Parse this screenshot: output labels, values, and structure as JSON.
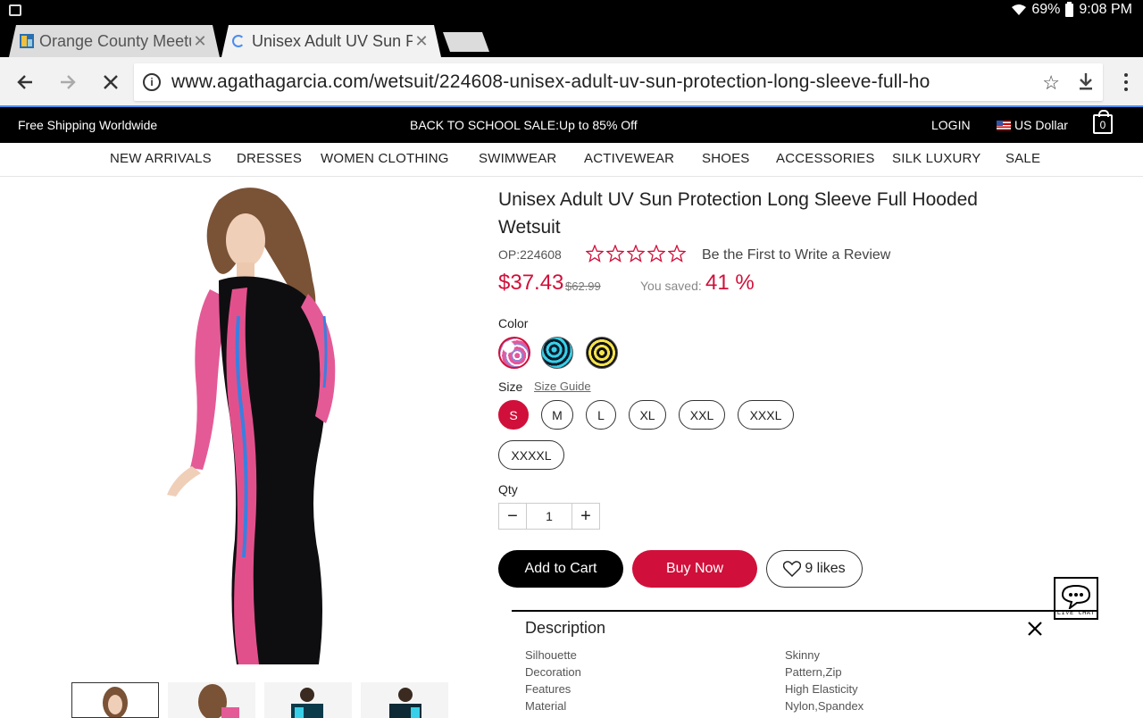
{
  "status": {
    "battery": "69%",
    "time": "9:08 PM"
  },
  "tabs": [
    {
      "title": "Orange County Meetup",
      "active": false
    },
    {
      "title": "Unisex Adult UV Sun Protection",
      "active": true
    }
  ],
  "address": {
    "url": "www.agathagarcia.com/wetsuit/224608-unisex-adult-uv-sun-protection-long-sleeve-full-ho"
  },
  "topbar": {
    "shipping": "Free Shipping Worldwide",
    "promo": "BACK TO SCHOOL SALE:Up to 85% Off",
    "login": "LOGIN",
    "currency": "US Dollar",
    "cart_count": "0"
  },
  "nav": [
    "NEW ARRIVALS",
    "DRESSES",
    "WOMEN CLOTHING",
    "SWIMWEAR",
    "ACTIVEWEAR",
    "SHOES",
    "ACCESSORIES",
    "SILK LUXURY",
    "SALE"
  ],
  "product": {
    "title": "Unisex Adult UV Sun Protection Long Sleeve Full Hooded Wetsuit",
    "sku": "OP:224608",
    "rating": 0,
    "review_link": "Be the First to Write a Review",
    "price": "$37.43",
    "old_price": "$62.99",
    "saved_label": "You saved:",
    "saved_pct": "41 %",
    "color_label": "Color",
    "size_label": "Size",
    "size_guide": "Size Guide",
    "sizes": [
      "S",
      "M",
      "L",
      "XL",
      "XXL",
      "XXXL",
      "XXXXL"
    ],
    "selected_size": "S",
    "qty_label": "Qty",
    "qty": "1",
    "add_to_cart": "Add to Cart",
    "buy_now": "Buy Now",
    "likes": "9 likes"
  },
  "livechat": {
    "label": "LIVE CHAT"
  },
  "description": {
    "title": "Description",
    "specs": [
      {
        "key": "Silhouette",
        "value": "Skinny"
      },
      {
        "key": "Decoration",
        "value": "Pattern,Zip"
      },
      {
        "key": "Features",
        "value": "High Elasticity"
      },
      {
        "key": "Material",
        "value": "Nylon,Spandex"
      }
    ]
  },
  "colors": {
    "brand_red": "#d0103a",
    "accent_blue": "#4a8cf0"
  }
}
